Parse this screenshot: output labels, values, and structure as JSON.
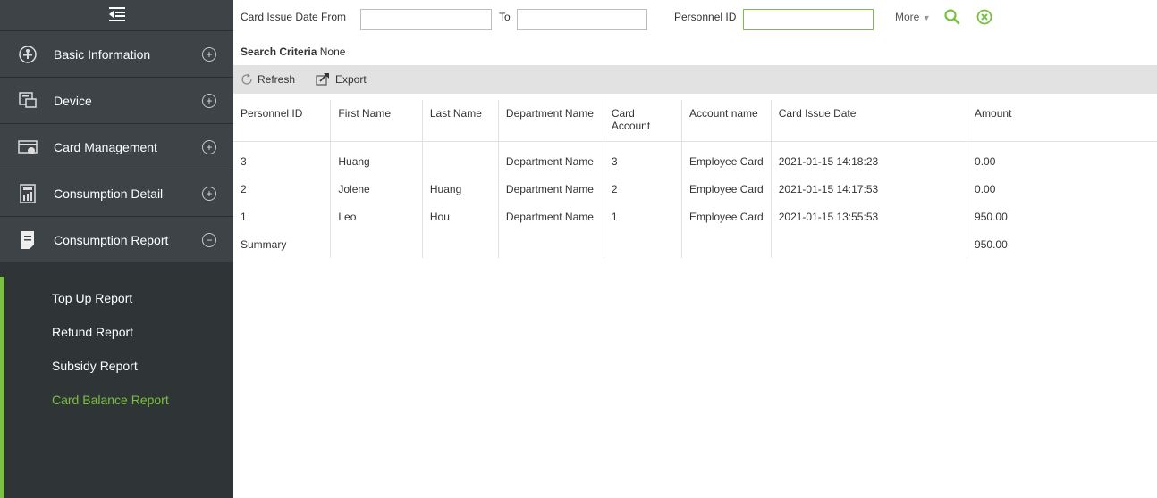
{
  "sidebar": {
    "menus": [
      {
        "label": "Basic Information",
        "icon": "basic-info-icon",
        "toggle": "+"
      },
      {
        "label": "Device",
        "icon": "device-icon",
        "toggle": "+"
      },
      {
        "label": "Card Management",
        "icon": "card-icon",
        "toggle": "+"
      },
      {
        "label": "Consumption Detail",
        "icon": "consumption-detail-icon",
        "toggle": "+"
      },
      {
        "label": "Consumption Report",
        "icon": "report-icon",
        "toggle": "−"
      }
    ],
    "submenu": [
      {
        "label": "Top Up Report"
      },
      {
        "label": "Refund Report"
      },
      {
        "label": "Subsidy Report"
      },
      {
        "label": "Card Balance Report",
        "active": true
      }
    ],
    "accent_color": "#7ac143"
  },
  "filter": {
    "date_from_label": "Card Issue Date From",
    "to_label": "To",
    "personnel_id_label": "Personnel ID",
    "more_label": "More",
    "date_from_value": "",
    "to_value": "",
    "personnel_id_value": ""
  },
  "search_criteria": {
    "label": "Search Criteria",
    "value": "None"
  },
  "toolbar": {
    "refresh_label": "Refresh",
    "export_label": "Export"
  },
  "table": {
    "headers": [
      "Personnel ID",
      "First Name",
      "Last Name",
      "Department Name",
      "Card Account",
      "Account name",
      "Card Issue Date",
      "Amount"
    ],
    "rows": [
      [
        "3",
        "Huang",
        "",
        "Department Name",
        "3",
        "Employee Card",
        "2021-01-15 14:18:23",
        "0.00"
      ],
      [
        "2",
        "Jolene",
        "Huang",
        "Department Name",
        "2",
        "Employee Card",
        "2021-01-15 14:17:53",
        "0.00"
      ],
      [
        "1",
        "Leo",
        "Hou",
        "Department Name",
        "1",
        "Employee Card",
        "2021-01-15 13:55:53",
        "950.00"
      ],
      [
        "Summary",
        "",
        "",
        "",
        "",
        "",
        "",
        "950.00"
      ]
    ]
  }
}
